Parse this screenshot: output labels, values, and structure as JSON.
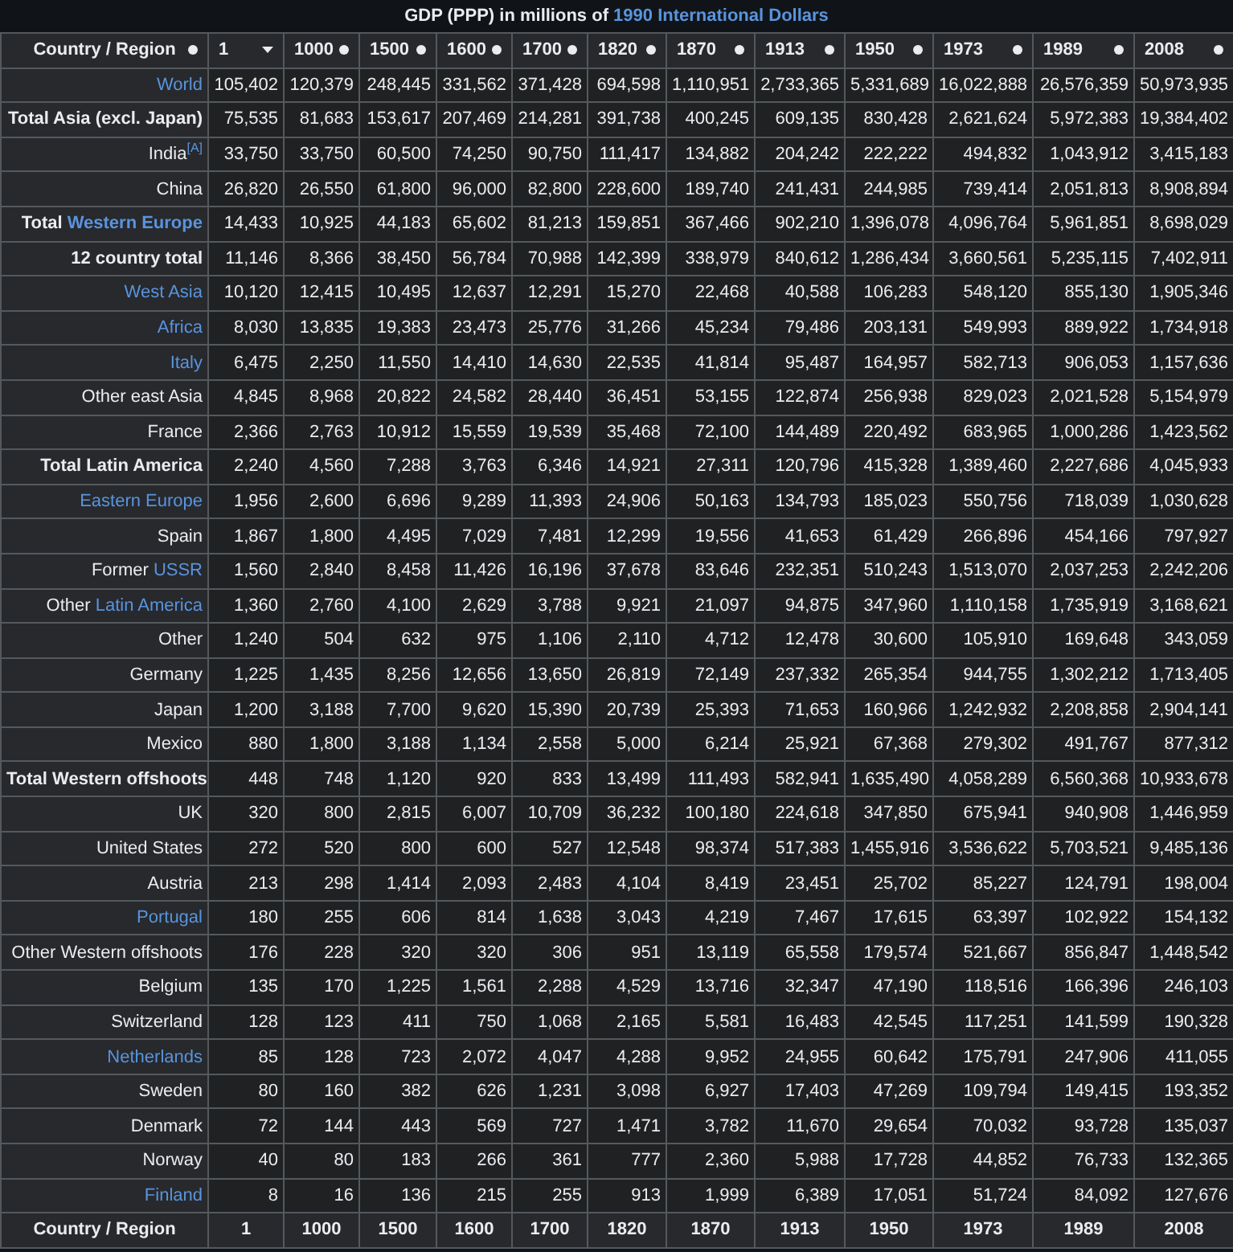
{
  "caption": [
    {
      "text": "GDP (PPP) in millions of ",
      "link": false
    },
    {
      "text": "1990 International Dollars",
      "link": true
    }
  ],
  "columns": [
    {
      "label": "Country / Region",
      "sorted": false
    },
    {
      "label": "1",
      "sorted": true
    },
    {
      "label": "1000",
      "sorted": false
    },
    {
      "label": "1500",
      "sorted": false
    },
    {
      "label": "1600",
      "sorted": false
    },
    {
      "label": "1700",
      "sorted": false
    },
    {
      "label": "1820",
      "sorted": false
    },
    {
      "label": "1870",
      "sorted": false
    },
    {
      "label": "1913",
      "sorted": false
    },
    {
      "label": "1950",
      "sorted": false
    },
    {
      "label": "1973",
      "sorted": false
    },
    {
      "label": "1989",
      "sorted": false
    },
    {
      "label": "2008",
      "sorted": false
    }
  ],
  "rows": [
    {
      "label": [
        {
          "text": "World",
          "link": true
        }
      ],
      "bold": false,
      "values": [
        "105,402",
        "120,379",
        "248,445",
        "331,562",
        "371,428",
        "694,598",
        "1,110,951",
        "2,733,365",
        "5,331,689",
        "16,022,888",
        "26,576,359",
        "50,973,935"
      ]
    },
    {
      "label": [
        {
          "text": "Total Asia (excl. Japan)",
          "link": false
        }
      ],
      "bold": true,
      "values": [
        "75,535",
        "81,683",
        "153,617",
        "207,469",
        "214,281",
        "391,738",
        "400,245",
        "609,135",
        "830,428",
        "2,621,624",
        "5,972,383",
        "19,384,402"
      ]
    },
    {
      "label": [
        {
          "text": "India",
          "link": false
        }
      ],
      "note": "[A]",
      "bold": false,
      "values": [
        "33,750",
        "33,750",
        "60,500",
        "74,250",
        "90,750",
        "111,417",
        "134,882",
        "204,242",
        "222,222",
        "494,832",
        "1,043,912",
        "3,415,183"
      ]
    },
    {
      "label": [
        {
          "text": "China",
          "link": false
        }
      ],
      "bold": false,
      "values": [
        "26,820",
        "26,550",
        "61,800",
        "96,000",
        "82,800",
        "228,600",
        "189,740",
        "241,431",
        "244,985",
        "739,414",
        "2,051,813",
        "8,908,894"
      ]
    },
    {
      "label": [
        {
          "text": "Total ",
          "link": false
        },
        {
          "text": "Western Europe",
          "link": true
        }
      ],
      "bold": true,
      "values": [
        "14,433",
        "10,925",
        "44,183",
        "65,602",
        "81,213",
        "159,851",
        "367,466",
        "902,210",
        "1,396,078",
        "4,096,764",
        "5,961,851",
        "8,698,029"
      ]
    },
    {
      "label": [
        {
          "text": "12 country total",
          "link": false
        }
      ],
      "bold": true,
      "values": [
        "11,146",
        "8,366",
        "38,450",
        "56,784",
        "70,988",
        "142,399",
        "338,979",
        "840,612",
        "1,286,434",
        "3,660,561",
        "5,235,115",
        "7,402,911"
      ]
    },
    {
      "label": [
        {
          "text": "West Asia",
          "link": true
        }
      ],
      "bold": false,
      "values": [
        "10,120",
        "12,415",
        "10,495",
        "12,637",
        "12,291",
        "15,270",
        "22,468",
        "40,588",
        "106,283",
        "548,120",
        "855,130",
        "1,905,346"
      ]
    },
    {
      "label": [
        {
          "text": "Africa",
          "link": true
        }
      ],
      "bold": false,
      "values": [
        "8,030",
        "13,835",
        "19,383",
        "23,473",
        "25,776",
        "31,266",
        "45,234",
        "79,486",
        "203,131",
        "549,993",
        "889,922",
        "1,734,918"
      ]
    },
    {
      "label": [
        {
          "text": "Italy",
          "link": true
        }
      ],
      "bold": false,
      "values": [
        "6,475",
        "2,250",
        "11,550",
        "14,410",
        "14,630",
        "22,535",
        "41,814",
        "95,487",
        "164,957",
        "582,713",
        "906,053",
        "1,157,636"
      ]
    },
    {
      "label": [
        {
          "text": "Other east Asia",
          "link": false
        }
      ],
      "bold": false,
      "values": [
        "4,845",
        "8,968",
        "20,822",
        "24,582",
        "28,440",
        "36,451",
        "53,155",
        "122,874",
        "256,938",
        "829,023",
        "2,021,528",
        "5,154,979"
      ]
    },
    {
      "label": [
        {
          "text": "France",
          "link": false
        }
      ],
      "bold": false,
      "values": [
        "2,366",
        "2,763",
        "10,912",
        "15,559",
        "19,539",
        "35,468",
        "72,100",
        "144,489",
        "220,492",
        "683,965",
        "1,000,286",
        "1,423,562"
      ]
    },
    {
      "label": [
        {
          "text": "Total Latin America",
          "link": false
        }
      ],
      "bold": true,
      "values": [
        "2,240",
        "4,560",
        "7,288",
        "3,763",
        "6,346",
        "14,921",
        "27,311",
        "120,796",
        "415,328",
        "1,389,460",
        "2,227,686",
        "4,045,933"
      ]
    },
    {
      "label": [
        {
          "text": "Eastern Europe",
          "link": true
        }
      ],
      "bold": false,
      "values": [
        "1,956",
        "2,600",
        "6,696",
        "9,289",
        "11,393",
        "24,906",
        "50,163",
        "134,793",
        "185,023",
        "550,756",
        "718,039",
        "1,030,628"
      ]
    },
    {
      "label": [
        {
          "text": "Spain",
          "link": false
        }
      ],
      "bold": false,
      "values": [
        "1,867",
        "1,800",
        "4,495",
        "7,029",
        "7,481",
        "12,299",
        "19,556",
        "41,653",
        "61,429",
        "266,896",
        "454,166",
        "797,927"
      ]
    },
    {
      "label": [
        {
          "text": "Former ",
          "link": false
        },
        {
          "text": "USSR",
          "link": true
        }
      ],
      "bold": false,
      "values": [
        "1,560",
        "2,840",
        "8,458",
        "11,426",
        "16,196",
        "37,678",
        "83,646",
        "232,351",
        "510,243",
        "1,513,070",
        "2,037,253",
        "2,242,206"
      ]
    },
    {
      "label": [
        {
          "text": "Other ",
          "link": false
        },
        {
          "text": "Latin America",
          "link": true
        }
      ],
      "bold": false,
      "values": [
        "1,360",
        "2,760",
        "4,100",
        "2,629",
        "3,788",
        "9,921",
        "21,097",
        "94,875",
        "347,960",
        "1,110,158",
        "1,735,919",
        "3,168,621"
      ]
    },
    {
      "label": [
        {
          "text": "Other",
          "link": false
        }
      ],
      "bold": false,
      "values": [
        "1,240",
        "504",
        "632",
        "975",
        "1,106",
        "2,110",
        "4,712",
        "12,478",
        "30,600",
        "105,910",
        "169,648",
        "343,059"
      ]
    },
    {
      "label": [
        {
          "text": "Germany",
          "link": false
        }
      ],
      "bold": false,
      "values": [
        "1,225",
        "1,435",
        "8,256",
        "12,656",
        "13,650",
        "26,819",
        "72,149",
        "237,332",
        "265,354",
        "944,755",
        "1,302,212",
        "1,713,405"
      ]
    },
    {
      "label": [
        {
          "text": "Japan",
          "link": false
        }
      ],
      "bold": false,
      "values": [
        "1,200",
        "3,188",
        "7,700",
        "9,620",
        "15,390",
        "20,739",
        "25,393",
        "71,653",
        "160,966",
        "1,242,932",
        "2,208,858",
        "2,904,141"
      ]
    },
    {
      "label": [
        {
          "text": "Mexico",
          "link": false
        }
      ],
      "bold": false,
      "values": [
        "880",
        "1,800",
        "3,188",
        "1,134",
        "2,558",
        "5,000",
        "6,214",
        "25,921",
        "67,368",
        "279,302",
        "491,767",
        "877,312"
      ]
    },
    {
      "label": [
        {
          "text": "Total Western offshoots",
          "link": false
        }
      ],
      "bold": true,
      "values": [
        "448",
        "748",
        "1,120",
        "920",
        "833",
        "13,499",
        "111,493",
        "582,941",
        "1,635,490",
        "4,058,289",
        "6,560,368",
        "10,933,678"
      ]
    },
    {
      "label": [
        {
          "text": "UK",
          "link": false
        }
      ],
      "bold": false,
      "values": [
        "320",
        "800",
        "2,815",
        "6,007",
        "10,709",
        "36,232",
        "100,180",
        "224,618",
        "347,850",
        "675,941",
        "940,908",
        "1,446,959"
      ]
    },
    {
      "label": [
        {
          "text": "United States",
          "link": false
        }
      ],
      "bold": false,
      "values": [
        "272",
        "520",
        "800",
        "600",
        "527",
        "12,548",
        "98,374",
        "517,383",
        "1,455,916",
        "3,536,622",
        "5,703,521",
        "9,485,136"
      ]
    },
    {
      "label": [
        {
          "text": "Austria",
          "link": false
        }
      ],
      "bold": false,
      "values": [
        "213",
        "298",
        "1,414",
        "2,093",
        "2,483",
        "4,104",
        "8,419",
        "23,451",
        "25,702",
        "85,227",
        "124,791",
        "198,004"
      ]
    },
    {
      "label": [
        {
          "text": "Portugal",
          "link": true
        }
      ],
      "bold": false,
      "values": [
        "180",
        "255",
        "606",
        "814",
        "1,638",
        "3,043",
        "4,219",
        "7,467",
        "17,615",
        "63,397",
        "102,922",
        "154,132"
      ]
    },
    {
      "label": [
        {
          "text": "Other Western offshoots",
          "link": false
        }
      ],
      "bold": false,
      "values": [
        "176",
        "228",
        "320",
        "320",
        "306",
        "951",
        "13,119",
        "65,558",
        "179,574",
        "521,667",
        "856,847",
        "1,448,542"
      ]
    },
    {
      "label": [
        {
          "text": "Belgium",
          "link": false
        }
      ],
      "bold": false,
      "values": [
        "135",
        "170",
        "1,225",
        "1,561",
        "2,288",
        "4,529",
        "13,716",
        "32,347",
        "47,190",
        "118,516",
        "166,396",
        "246,103"
      ]
    },
    {
      "label": [
        {
          "text": "Switzerland",
          "link": false
        }
      ],
      "bold": false,
      "values": [
        "128",
        "123",
        "411",
        "750",
        "1,068",
        "2,165",
        "5,581",
        "16,483",
        "42,545",
        "117,251",
        "141,599",
        "190,328"
      ]
    },
    {
      "label": [
        {
          "text": "Netherlands",
          "link": true
        }
      ],
      "bold": false,
      "values": [
        "85",
        "128",
        "723",
        "2,072",
        "4,047",
        "4,288",
        "9,952",
        "24,955",
        "60,642",
        "175,791",
        "247,906",
        "411,055"
      ]
    },
    {
      "label": [
        {
          "text": "Sweden",
          "link": false
        }
      ],
      "bold": false,
      "values": [
        "80",
        "160",
        "382",
        "626",
        "1,231",
        "3,098",
        "6,927",
        "17,403",
        "47,269",
        "109,794",
        "149,415",
        "193,352"
      ]
    },
    {
      "label": [
        {
          "text": "Denmark",
          "link": false
        }
      ],
      "bold": false,
      "values": [
        "72",
        "144",
        "443",
        "569",
        "727",
        "1,471",
        "3,782",
        "11,670",
        "29,654",
        "70,032",
        "93,728",
        "135,037"
      ]
    },
    {
      "label": [
        {
          "text": "Norway",
          "link": false
        }
      ],
      "bold": false,
      "values": [
        "40",
        "80",
        "183",
        "266",
        "361",
        "777",
        "2,360",
        "5,988",
        "17,728",
        "44,852",
        "76,733",
        "132,365"
      ]
    },
    {
      "label": [
        {
          "text": "Finland",
          "link": true
        }
      ],
      "bold": false,
      "values": [
        "8",
        "16",
        "136",
        "215",
        "255",
        "913",
        "1,999",
        "6,389",
        "17,051",
        "51,724",
        "84,092",
        "127,676"
      ]
    }
  ],
  "footer": [
    "Country / Region",
    "1",
    "1000",
    "1500",
    "1600",
    "1700",
    "1820",
    "1870",
    "1913",
    "1950",
    "1973",
    "1989",
    "2008"
  ]
}
